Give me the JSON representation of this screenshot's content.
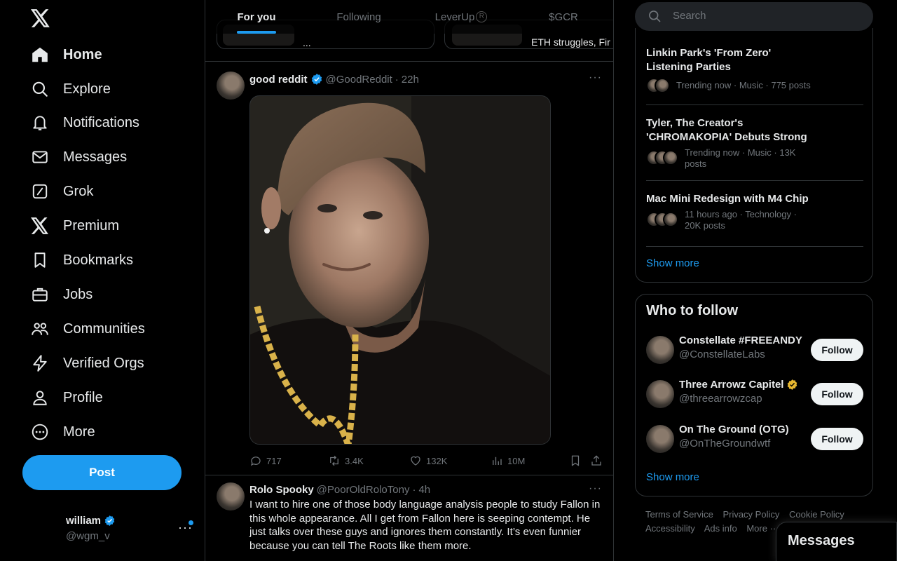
{
  "sidebar": {
    "items": [
      {
        "label": "Home",
        "icon": "home-icon"
      },
      {
        "label": "Explore",
        "icon": "search-icon"
      },
      {
        "label": "Notifications",
        "icon": "bell-icon"
      },
      {
        "label": "Messages",
        "icon": "envelope-icon"
      },
      {
        "label": "Grok",
        "icon": "grok-icon"
      },
      {
        "label": "Premium",
        "icon": "x-logo-icon"
      },
      {
        "label": "Bookmarks",
        "icon": "bookmark-icon"
      },
      {
        "label": "Jobs",
        "icon": "briefcase-icon"
      },
      {
        "label": "Communities",
        "icon": "people-icon"
      },
      {
        "label": "Verified Orgs",
        "icon": "lightning-icon"
      },
      {
        "label": "Profile",
        "icon": "person-icon"
      },
      {
        "label": "More",
        "icon": "more-circle-icon"
      }
    ],
    "post_label": "Post",
    "account": {
      "name": "william",
      "handle": "@wgm_v"
    }
  },
  "feed": {
    "tabs": [
      "For you",
      "Following",
      "LeverUp",
      "$GCR"
    ],
    "carousel": {
      "card1_text": "...",
      "card2_text": "ETH struggles, Fir"
    },
    "tweets": [
      {
        "name": "good reddit",
        "handle": "@GoodReddit",
        "time": "22h",
        "replies": "717",
        "reposts": "3.4K",
        "likes": "132K",
        "views": "10M"
      },
      {
        "name": "Rolo Spooky",
        "handle": "@PoorOldRoloTony",
        "time": "4h",
        "text": "I want to hire one of those body language analysis people to study Fallon in this whole appearance. All I get from Fallon here is seeping contempt. He just talks over these guys and ignores them constantly. It’s even funnier because you can tell The Roots like them more."
      }
    ]
  },
  "right": {
    "search_placeholder": "Search",
    "trends": [
      {
        "title": "Linkin Park's 'From Zero' Listening Parties",
        "meta": "Trending now · Music · 775 posts"
      },
      {
        "title": "Tyler, The Creator's 'CHROMAKOPIA' Debuts Strong",
        "meta": "Trending now · Music · 13K posts"
      },
      {
        "title": "Mac Mini Redesign with M4 Chip",
        "meta": "11 hours ago · Technology · 20K posts"
      }
    ],
    "show_more": "Show more",
    "who_to_follow": {
      "title": "Who to follow",
      "accounts": [
        {
          "name": "Constellate #FREEANDY",
          "handle": "@ConstellateLabs",
          "button": "Follow"
        },
        {
          "name": "Three Arrowz Capitel",
          "handle": "@threearrowzcap",
          "button": "Follow"
        },
        {
          "name": "On The Ground (OTG)",
          "handle": "@OnTheGroundwtf",
          "button": "Follow"
        }
      ],
      "show_more": "Show more"
    },
    "footer": {
      "links": [
        "Terms of Service",
        "Privacy Policy",
        "Cookie Policy",
        "Accessibility",
        "Ads info",
        "More ···"
      ]
    }
  },
  "messages_drawer": {
    "title": "Messages"
  },
  "colors": {
    "accent": "#1d9bf0",
    "background": "#000000",
    "border": "#2f3336",
    "secondary_text": "#71767b",
    "verified_gold": "#e8b830"
  }
}
